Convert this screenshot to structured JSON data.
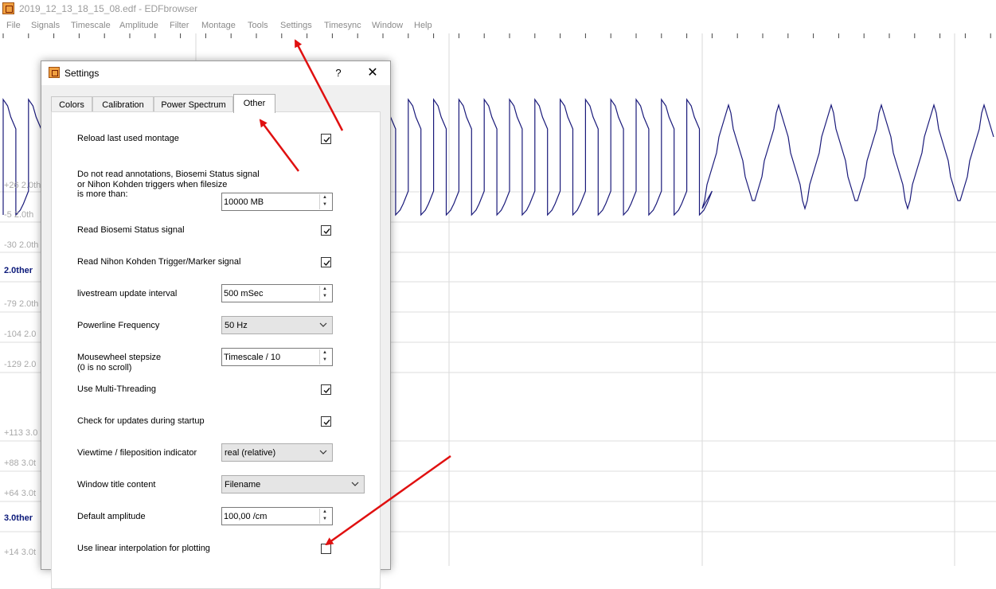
{
  "window": {
    "title": "2019_12_13_18_15_08.edf - EDFbrowser",
    "app_icon": "edfbrowser-icon"
  },
  "menu": [
    "File",
    "Signals",
    "Timescale",
    "Amplitude",
    "Filter",
    "Montage",
    "Tools",
    "Settings",
    "Timesync",
    "Window",
    "Help"
  ],
  "plot": {
    "trace_color": "#1a1a7a",
    "label_color": "#a8a8a8",
    "signal_labels": [
      {
        "text": "+26 2.0th"
      },
      {
        "text": "-5 2.0th"
      },
      {
        "text": "-30 2.0th"
      },
      {
        "text": "2.0ther",
        "emphasis": true
      },
      {
        "text": "-79 2.0th"
      },
      {
        "text": "-104 2.0"
      },
      {
        "text": "-129 2.0"
      },
      {
        "text": "+113 3.0"
      },
      {
        "text": "+88 3.0t"
      },
      {
        "text": "+64 3.0t"
      },
      {
        "text": "3.0ther",
        "emphasis": true
      },
      {
        "text": "+14 3.0t"
      }
    ]
  },
  "dialog": {
    "title": "Settings",
    "help_glyph": "?",
    "close_glyph": "✕",
    "tabs": [
      {
        "label": "Colors",
        "active": false
      },
      {
        "label": "Calibration",
        "active": false
      },
      {
        "label": "Power Spectrum",
        "active": false
      },
      {
        "label": "Other",
        "active": true
      }
    ],
    "rows": {
      "reload_montage": {
        "label": "Reload last used montage",
        "checked": true
      },
      "annotations": {
        "label_line1": "Do not read annotations, Biosemi Status signal",
        "label_line2": "or Nihon Kohden triggers when filesize",
        "label_line3": "is more than:",
        "value": "10000 MB"
      },
      "biosemi": {
        "label": "Read Biosemi Status signal",
        "checked": true
      },
      "nihon": {
        "label": "Read Nihon Kohden Trigger/Marker signal",
        "checked": true
      },
      "livestream": {
        "label": "livestream update interval",
        "value": "500 mSec"
      },
      "powerline": {
        "label": "Powerline Frequency",
        "value": "50 Hz"
      },
      "mousewheel": {
        "label_line1": "Mousewheel stepsize",
        "label_line2": "(0 is no scroll)",
        "value": "Timescale / 10"
      },
      "multithreading": {
        "label": "Use Multi-Threading",
        "checked": true
      },
      "updates": {
        "label": "Check for updates during startup",
        "checked": true
      },
      "viewtime": {
        "label": "Viewtime / fileposition indicator",
        "value": "real (relative)"
      },
      "window_title": {
        "label": "Window title content",
        "value": "Filename"
      },
      "amplitude": {
        "label": "Default amplitude",
        "value": "100,00 /cm"
      },
      "interpolation": {
        "label": "Use linear interpolation for plotting",
        "checked": false
      }
    }
  },
  "annotation_arrows": {
    "color": "#e01010",
    "count": 3
  }
}
